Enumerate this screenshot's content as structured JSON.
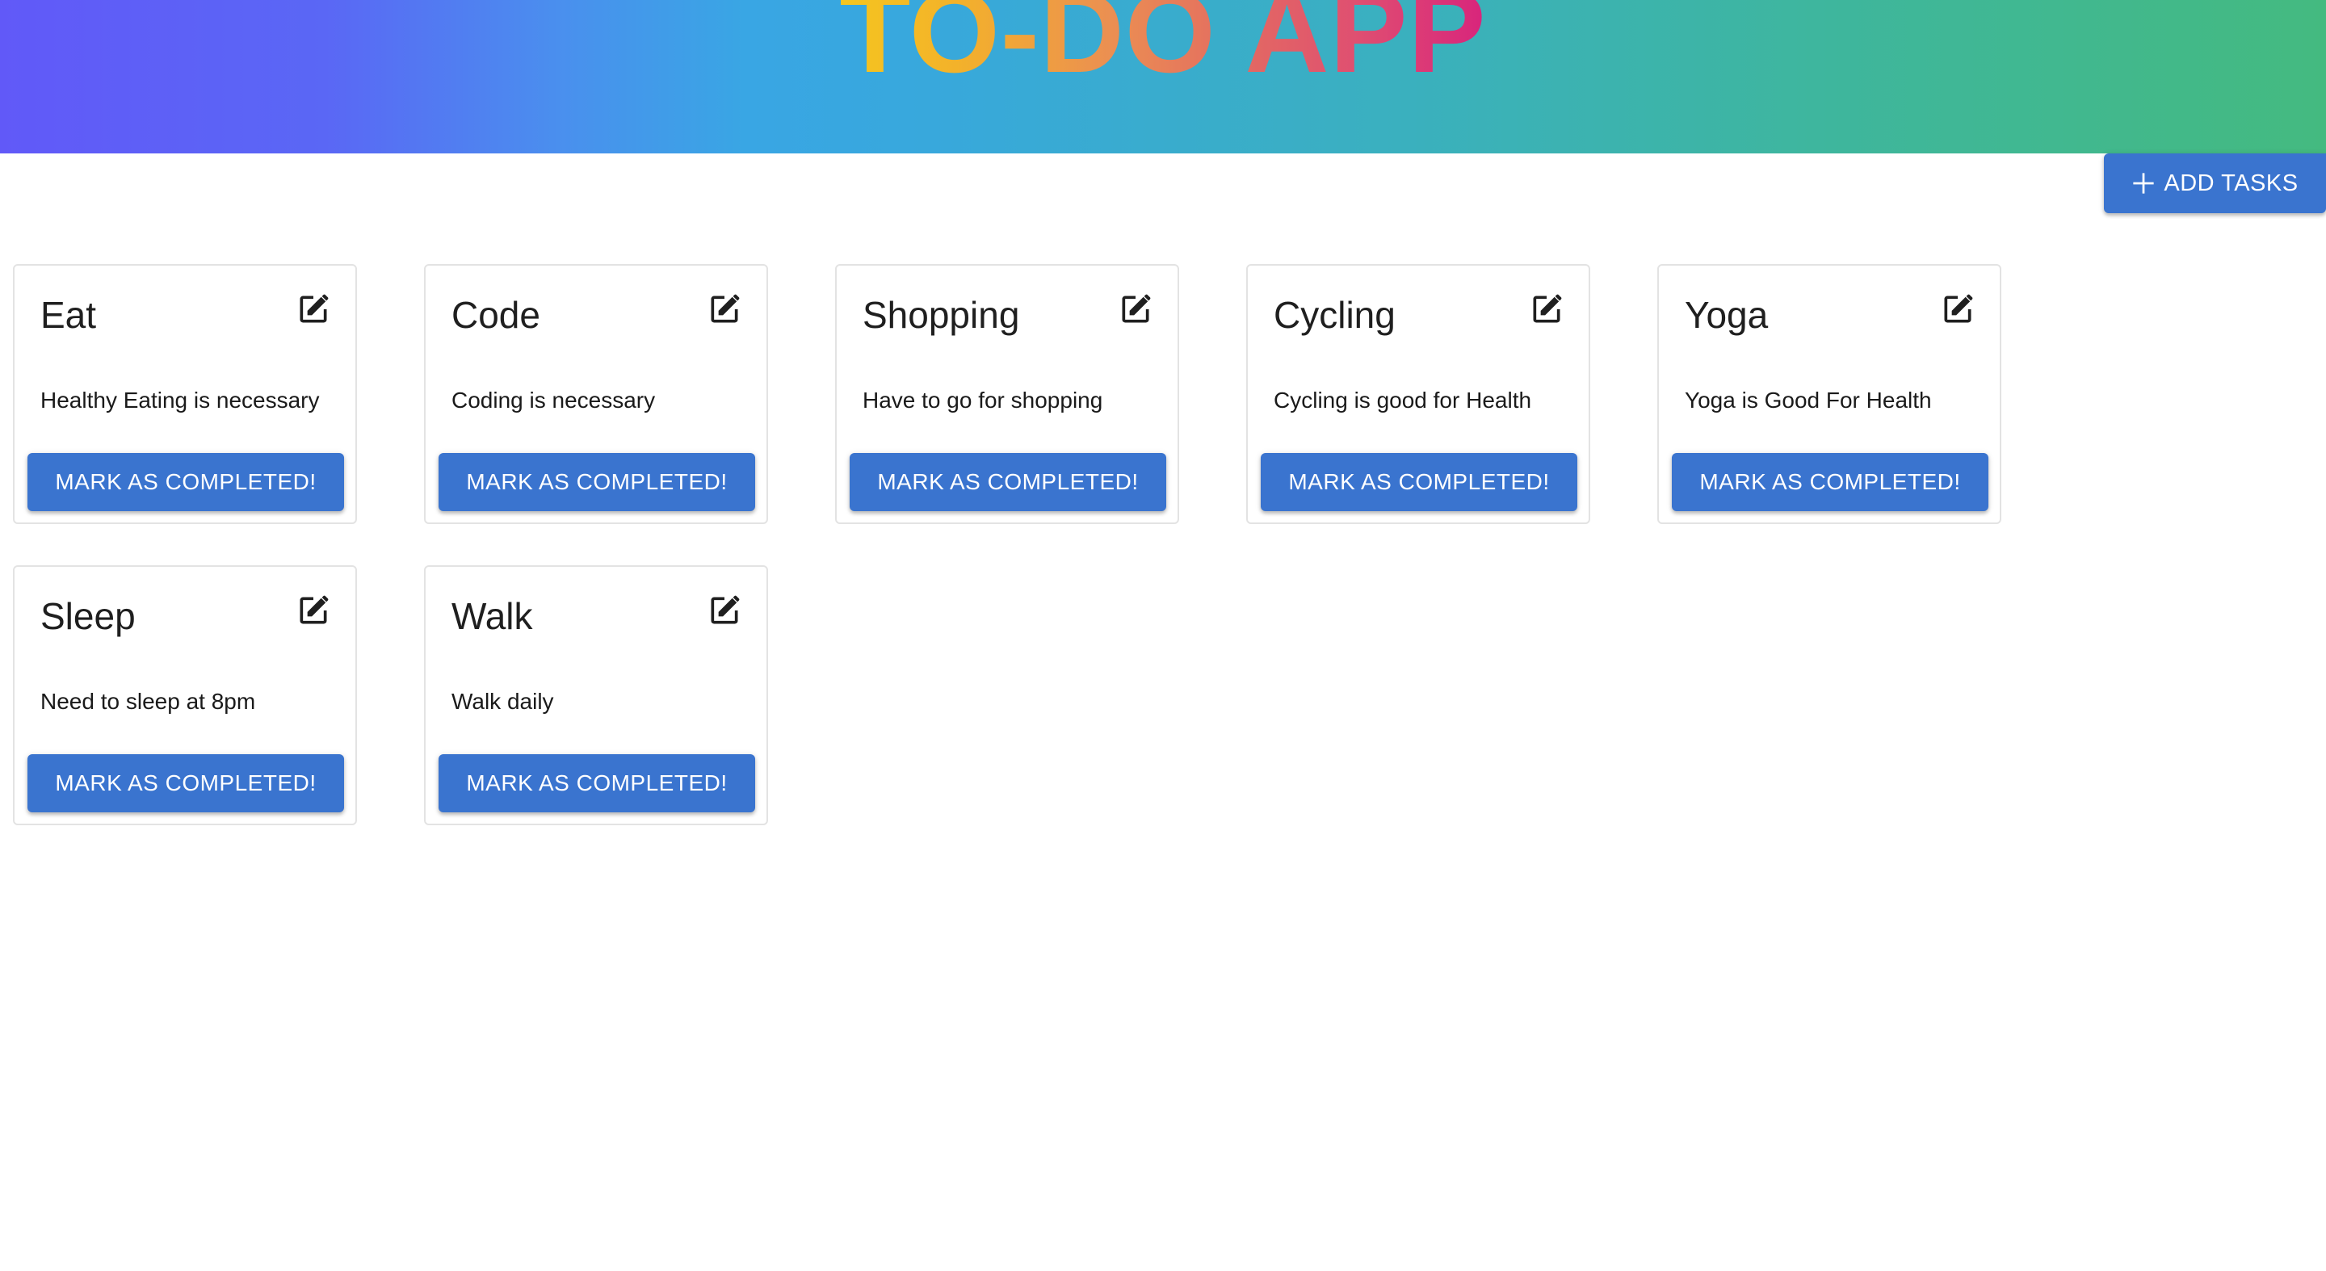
{
  "app": {
    "title": "TO-DO APP"
  },
  "toolbar": {
    "add_label": "ADD TASKS",
    "add_icon": "plus-icon"
  },
  "colors": {
    "primary_button": "#3a74cf",
    "header_gradient": [
      "#6159f8",
      "#38a8dc",
      "#44ba80"
    ],
    "title_gradient": [
      "#f5c61f",
      "#eb8f52",
      "#d8247c"
    ]
  },
  "tasks": [
    {
      "title": "Eat",
      "description": "Healthy Eating is necessary",
      "button": "MARK AS COMPLETED!",
      "icon": "edit-icon"
    },
    {
      "title": "Code",
      "description": "Coding is necessary",
      "button": "MARK AS COMPLETED!",
      "icon": "edit-icon"
    },
    {
      "title": "Shopping",
      "description": "Have to go for shopping",
      "button": "MARK AS COMPLETED!",
      "icon": "edit-icon"
    },
    {
      "title": "Cycling",
      "description": "Cycling is good for Health",
      "button": "MARK AS COMPLETED!",
      "icon": "edit-icon"
    },
    {
      "title": "Yoga",
      "description": "Yoga is Good For Health",
      "button": "MARK AS COMPLETED!",
      "icon": "edit-icon"
    },
    {
      "title": "Sleep",
      "description": "Need to sleep at 8pm",
      "button": "MARK AS COMPLETED!",
      "icon": "edit-icon"
    },
    {
      "title": "Walk",
      "description": "Walk daily",
      "button": "MARK AS COMPLETED!",
      "icon": "edit-icon"
    }
  ]
}
